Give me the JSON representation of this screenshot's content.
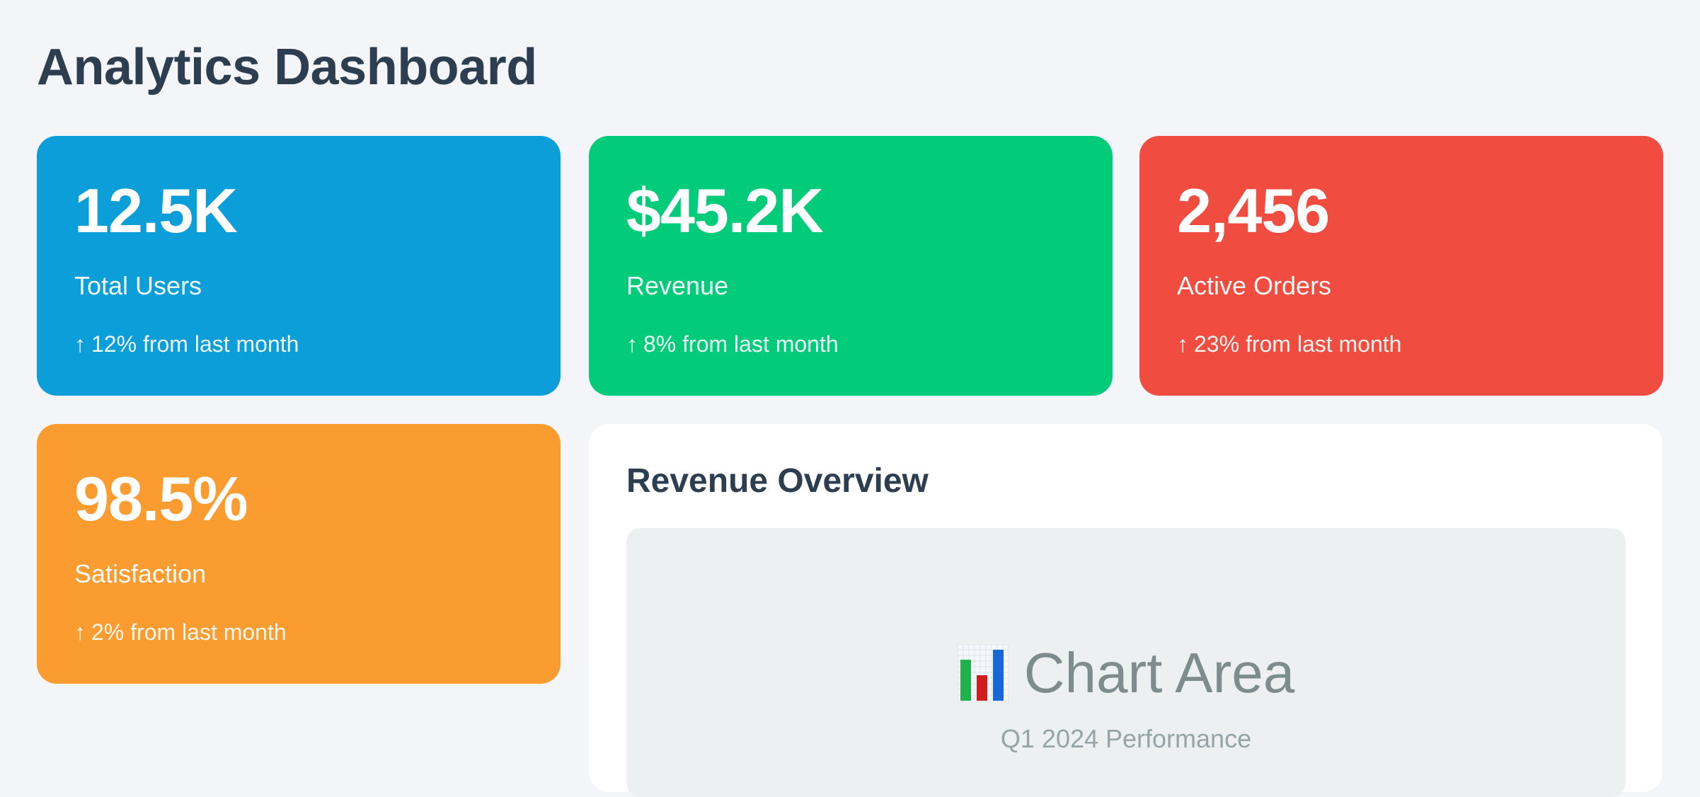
{
  "header": {
    "title": "Analytics Dashboard"
  },
  "stats": [
    {
      "value": "12.5K",
      "label": "Total Users",
      "arrow": "↑",
      "change": "12% from last month",
      "color": "#0c9ed9"
    },
    {
      "value": "$45.2K",
      "label": "Revenue",
      "arrow": "↑",
      "change": "8% from last month",
      "color": "#02cb79"
    },
    {
      "value": "2,456",
      "label": "Active Orders",
      "arrow": "↑",
      "change": "23% from last month",
      "color": "#f04c40"
    },
    {
      "value": "98.5%",
      "label": "Satisfaction",
      "arrow": "↑",
      "change": "2% from last month",
      "color": "#fa9c2f"
    }
  ],
  "revenue_overview": {
    "title": "Revenue Overview",
    "placeholder_icon": "bar-chart-icon",
    "placeholder_text": "Chart Area",
    "subtitle": "Q1 2024 Performance"
  },
  "colors": {
    "background": "#f4f5f8",
    "heading": "#2c3e50",
    "chart_area_bg": "#ecf0f1",
    "muted_text": "#7f8c8d"
  }
}
